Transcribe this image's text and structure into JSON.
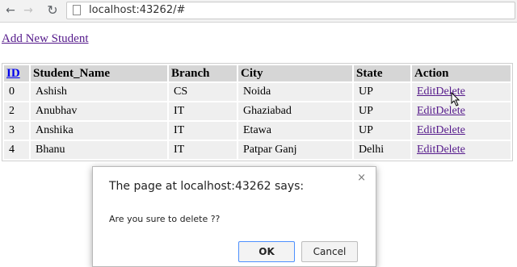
{
  "browser": {
    "url": "localhost:43262/#",
    "back_icon": "←",
    "forward_icon": "→",
    "reload_icon": "↻"
  },
  "page": {
    "add_link": "Add New Student",
    "table": {
      "headers": [
        "ID",
        "Student_Name",
        "Branch",
        "City",
        "State",
        "Action"
      ],
      "rows": [
        {
          "id": "0",
          "name": "Ashish",
          "branch": "CS",
          "city": "Noida",
          "state": "UP",
          "edit": "Edit",
          "delete": "Delete"
        },
        {
          "id": "2",
          "name": "Anubhav",
          "branch": "IT",
          "city": "Ghaziabad",
          "state": "UP",
          "edit": "Edit",
          "delete": "Delete"
        },
        {
          "id": "3",
          "name": "Anshika",
          "branch": "IT",
          "city": "Etawa",
          "state": "UP",
          "edit": "Edit",
          "delete": "Delete"
        },
        {
          "id": "4",
          "name": "Bhanu",
          "branch": "IT",
          "city": "Patpar Ganj",
          "state": "Delhi",
          "edit": "Edit",
          "delete": "Delete"
        }
      ]
    }
  },
  "dialog": {
    "title": "The page at localhost:43262 says:",
    "message": "Are you sure to delete ??",
    "ok_label": "OK",
    "cancel_label": "Cancel",
    "close_icon": "×"
  },
  "colors": {
    "link_visited": "#551a8b",
    "link_header": "#0000ee",
    "header_bg": "#d6d6d6",
    "row_bg": "#efefef",
    "ok_focus": "#4d90fe"
  }
}
